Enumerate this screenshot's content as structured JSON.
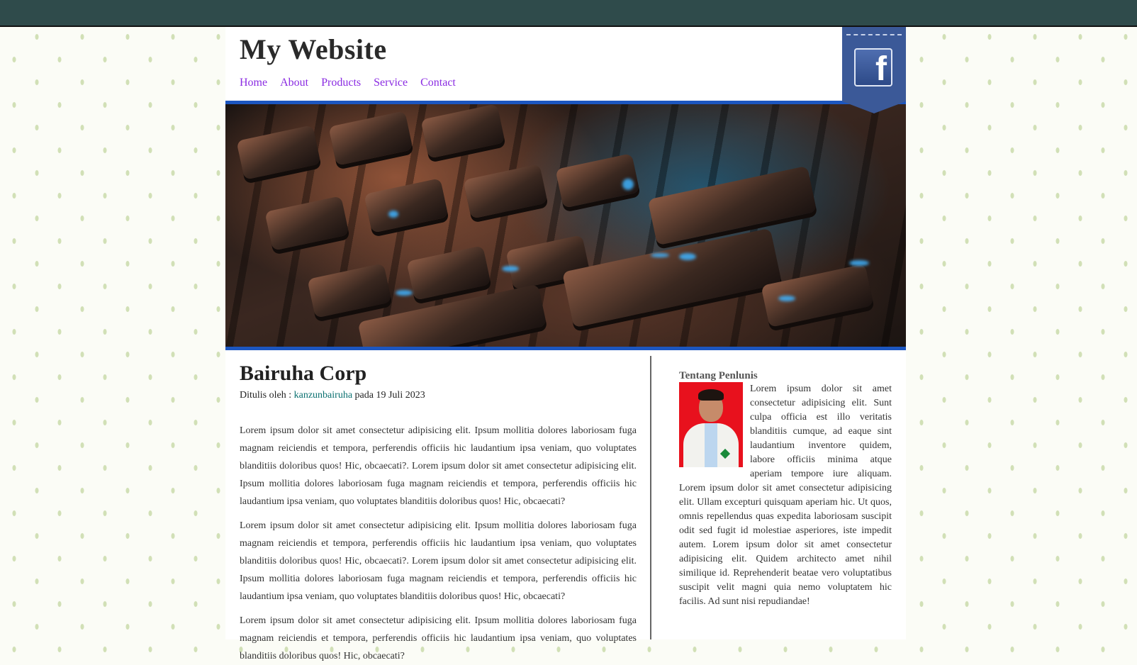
{
  "site": {
    "title": "My Website"
  },
  "nav": {
    "items": [
      "Home",
      "About",
      "Products",
      "Service",
      "Contact"
    ]
  },
  "social": {
    "icon": "facebook-icon",
    "glyph": "f",
    "color": "#3b5998"
  },
  "hero": {
    "image": "keyboard-photo",
    "border_color": "#1c56c0"
  },
  "article": {
    "title": "Bairuha Corp",
    "byline_prefix": "Ditulis oleh : ",
    "author": "kanzunbairuha",
    "byline_suffix": " pada 19 Juli 2023",
    "paragraphs": [
      "Lorem ipsum dolor sit amet consectetur adipisicing elit. Ipsum mollitia dolores laboriosam fuga magnam reiciendis et tempora, perferendis officiis hic laudantium ipsa veniam, quo voluptates blanditiis doloribus quos! Hic, obcaecati?. Lorem ipsum dolor sit amet consectetur adipisicing elit. Ipsum mollitia dolores laboriosam fuga magnam reiciendis et tempora, perferendis officiis hic laudantium ipsa veniam, quo voluptates blanditiis doloribus quos! Hic, obcaecati?",
      "Lorem ipsum dolor sit amet consectetur adipisicing elit. Ipsum mollitia dolores laboriosam fuga magnam reiciendis et tempora, perferendis officiis hic laudantium ipsa veniam, quo voluptates blanditiis doloribus quos! Hic, obcaecati?. Lorem ipsum dolor sit amet consectetur adipisicing elit. Ipsum mollitia dolores laboriosam fuga magnam reiciendis et tempora, perferendis officiis hic laudantium ipsa veniam, quo voluptates blanditiis doloribus quos! Hic, obcaecati?",
      "Lorem ipsum dolor sit amet consectetur adipisicing elit. Ipsum mollitia dolores laboriosam fuga magnam reiciendis et tempora, perferendis officiis hic laudantium ipsa veniam, quo voluptates blanditiis doloribus quos! Hic, obcaecati?"
    ]
  },
  "sidebar": {
    "heading": "Tentang Penlunis",
    "bio": "Lorem ipsum dolor sit amet consectetur adipisicing elit. Sunt culpa officia est illo veritatis blanditiis cumque, ad eaque sint laudantium inventore quidem, labore officiis minima atque aperiam tempore iure aliquam. Lorem ipsum dolor sit amet consectetur adipisicing elit. Ullam excepturi quisquam aperiam hic. Ut quos, omnis repellendus quas expedita laboriosam suscipit odit sed fugit id molestiae asperiores, iste impedit autem. Lorem ipsum dolor sit amet consectetur adipisicing elit. Quidem architecto amet nihil similique id. Reprehenderit beatae vero voluptatibus suscipit velit magni quia nemo voluptatem hic facilis. Ad sunt nisi repudiandae!"
  },
  "colors": {
    "topbar": "#2f4b4b",
    "nav_link": "#8a2be2",
    "author_link": "#0a7070",
    "divider": "#666666"
  }
}
